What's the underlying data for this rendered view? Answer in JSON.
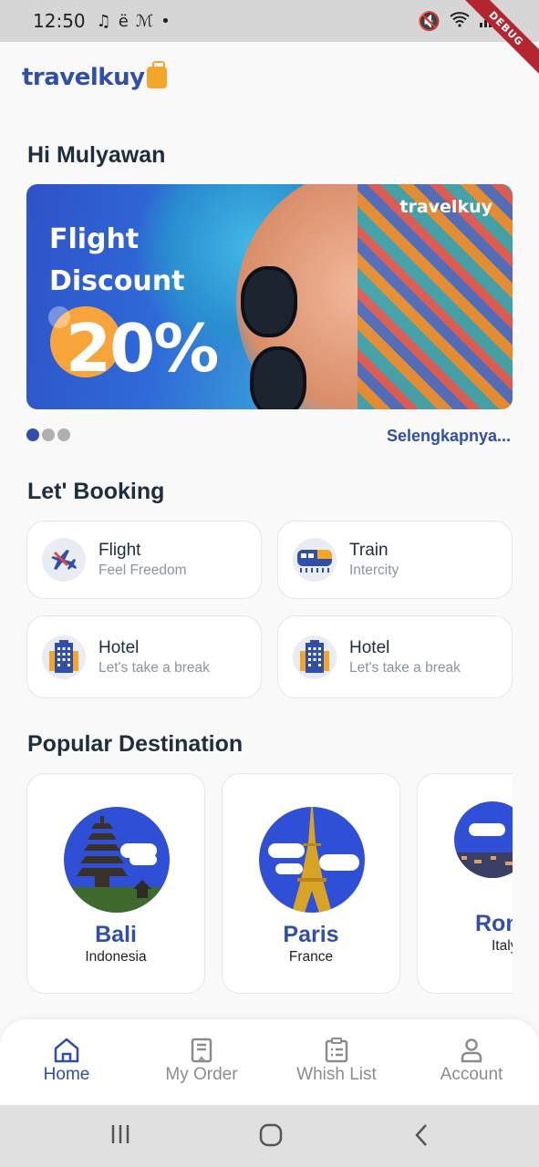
{
  "status_bar": {
    "time": "12:50",
    "debug_label": "DEBUG"
  },
  "app": {
    "logo_text": "travelkuy",
    "greeting": "Hi Mulyawan"
  },
  "banner": {
    "brand": "travelkuy",
    "title_line1": "Flight",
    "title_line2": "Discount",
    "percent": "20%",
    "more_link": "Selengkapnya...",
    "active_dot": 0,
    "dot_count": 3
  },
  "booking": {
    "title": "Let' Booking",
    "items": [
      {
        "title": "Flight",
        "subtitle": "Feel Freedom",
        "icon": "airplane-icon"
      },
      {
        "title": "Train",
        "subtitle": "Intercity",
        "icon": "train-icon"
      },
      {
        "title": "Hotel",
        "subtitle": "Let's take a break",
        "icon": "hotel-icon"
      },
      {
        "title": "Hotel",
        "subtitle": "Let's take a break",
        "icon": "hotel-icon"
      }
    ]
  },
  "popular": {
    "title": "Popular Destination",
    "items": [
      {
        "name": "Bali",
        "country": "Indonesia"
      },
      {
        "name": "Paris",
        "country": "France"
      },
      {
        "name": "Rome",
        "country": "Italy"
      }
    ]
  },
  "bottom_nav": {
    "items": [
      {
        "label": "Home",
        "icon": "home-icon",
        "active": true
      },
      {
        "label": "My Order",
        "icon": "receipt-icon",
        "active": false
      },
      {
        "label": "Whish List",
        "icon": "clipboard-list-icon",
        "active": false
      },
      {
        "label": "Account",
        "icon": "person-icon",
        "active": false
      }
    ]
  },
  "colors": {
    "primary": "#2f4fa8",
    "accent": "#f4a62a",
    "text": "#1f2d3d",
    "muted": "#8a94a0"
  }
}
